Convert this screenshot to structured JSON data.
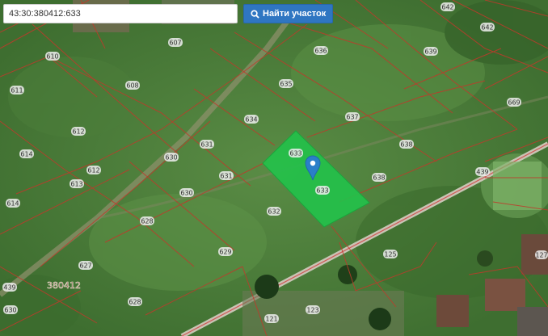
{
  "search": {
    "value": "43:30:380412:633",
    "button_label": "Найти участок",
    "button_icon": "search-icon"
  },
  "map": {
    "quarter_label": "380412",
    "selected_parcel": "633",
    "selected_color": "#22c24a",
    "boundary_color": "#c0392b",
    "marker_icon": "map-pin-icon",
    "parcel_labels": [
      "607",
      "610",
      "611",
      "608",
      "612",
      "614",
      "612",
      "613",
      "614",
      "631",
      "630",
      "631",
      "630",
      "632",
      "628",
      "627",
      "629",
      "439",
      "635",
      "636",
      "634",
      "637",
      "633",
      "633",
      "638",
      "639",
      "642",
      "642",
      "669",
      "638",
      "439",
      "125",
      "127",
      "123",
      "121",
      "628",
      "630",
      "380"
    ]
  }
}
